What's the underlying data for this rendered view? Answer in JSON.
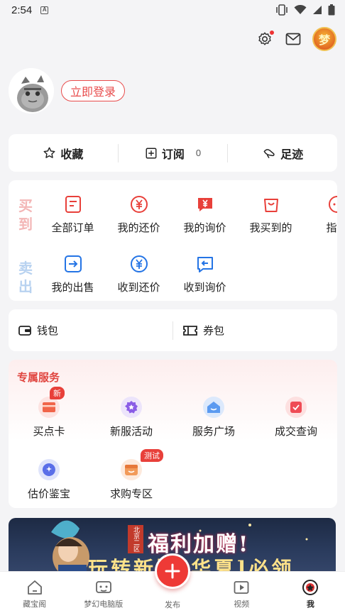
{
  "status": {
    "time": "2:54",
    "sim": "A"
  },
  "header": {
    "game_avatar_text": "梦"
  },
  "profile": {
    "login_label": "立即登录"
  },
  "quick": {
    "favorites": "收藏",
    "subscribe": "订阅",
    "subscribe_count": "0",
    "footprint": "足迹"
  },
  "orders": {
    "buy_label": "买到",
    "sell_label": "卖出",
    "buy_items": [
      "全部订单",
      "我的还价",
      "我的询价",
      "我买到的",
      "指定"
    ],
    "sell_items": [
      "我的出售",
      "收到还价",
      "收到询价"
    ]
  },
  "wallet": {
    "wallet_label": "钱包",
    "coupon_label": "券包"
  },
  "services": {
    "title": "专属服务",
    "items": [
      "买点卡",
      "新服活动",
      "服务广场",
      "成交查询",
      "估价鉴宝",
      "求购专区"
    ],
    "badge_new": "新",
    "badge_test": "测试"
  },
  "banner": {
    "text": "福利加赠!",
    "subtext": "玩转新版[华夏]必领",
    "ornament": "北京二区"
  },
  "tabs": [
    "藏宝阁",
    "梦幻电脑版",
    "发布",
    "视频",
    "我"
  ],
  "colors": {
    "accent": "#e84b4b",
    "buy": "#f3b6b6",
    "sell": "#b8d2f0"
  }
}
